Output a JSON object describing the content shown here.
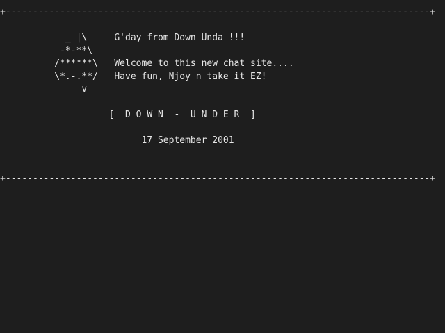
{
  "screen": {
    "border_top": "+------------------------------------------------------------------------------+",
    "lines": [
      "            _ |\\     G'day from Down Unda !!!",
      "           -*-**\\",
      "          /******\\   Welcome to this new chat site....",
      "          \\*.-.**/   Have fun, Njoy n take it EZ!",
      "               v",
      "",
      "                    [  D O W N  -  U N D E R  ]",
      "",
      "                          17 September 2001"
    ],
    "border_bottom": "+------------------------------------------------------------------------------+"
  }
}
